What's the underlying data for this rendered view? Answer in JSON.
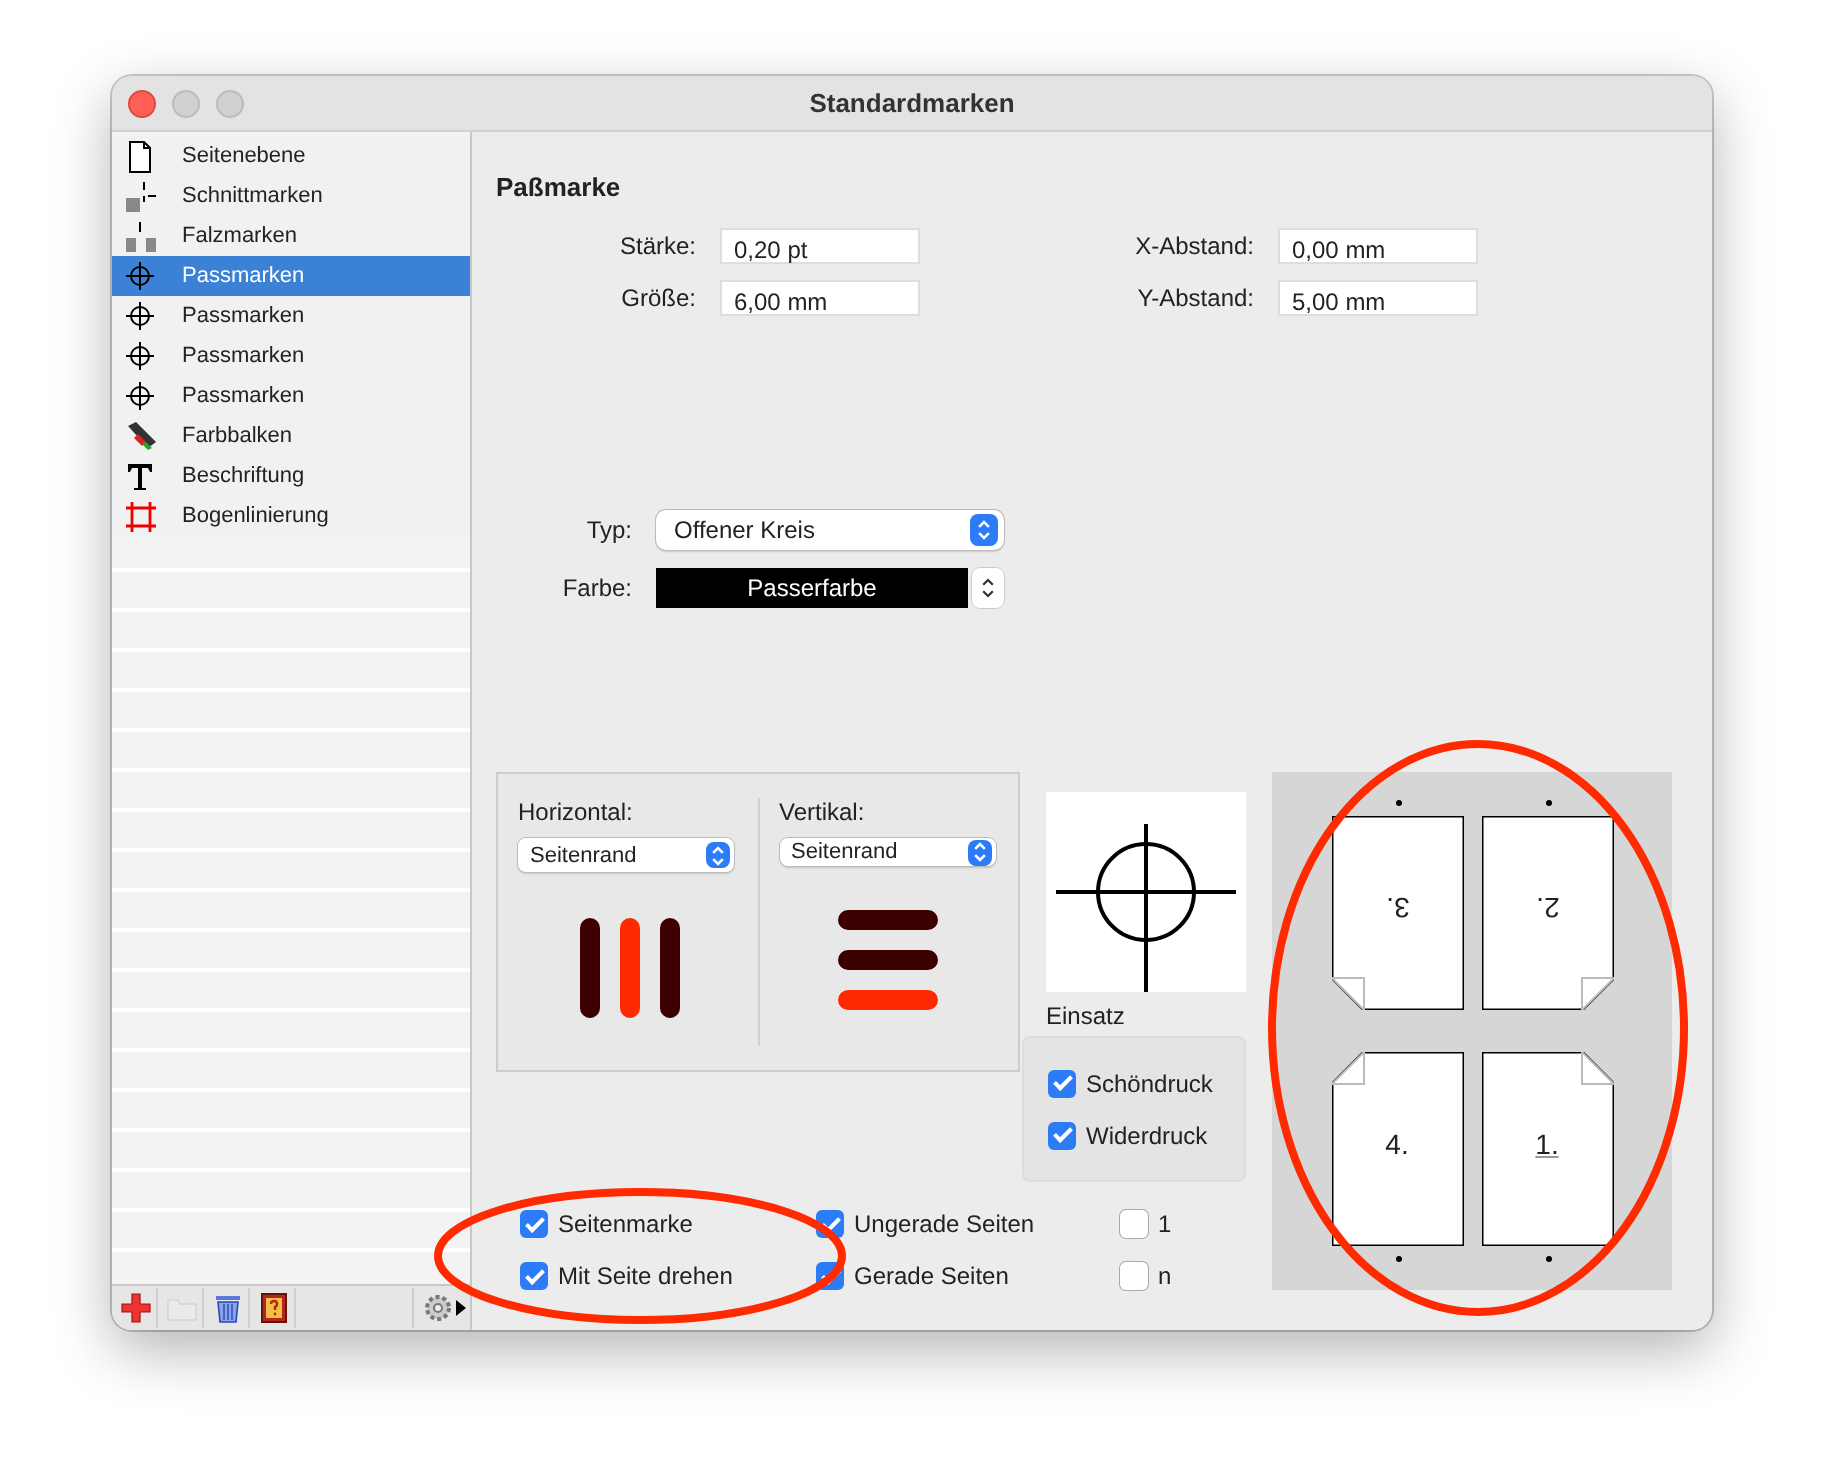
{
  "window": {
    "title": "Standardmarken"
  },
  "sidebar": {
    "items": [
      {
        "label": "Seitenebene",
        "kind": "page",
        "selected": false
      },
      {
        "label": "Schnittmarken",
        "kind": "cut",
        "selected": false
      },
      {
        "label": "Falzmarken",
        "kind": "fold",
        "selected": false
      },
      {
        "label": "Passmarken",
        "kind": "register",
        "selected": true
      },
      {
        "label": "Passmarken",
        "kind": "register",
        "selected": false
      },
      {
        "label": "Passmarken",
        "kind": "register",
        "selected": false
      },
      {
        "label": "Passmarken",
        "kind": "register",
        "selected": false
      },
      {
        "label": "Farbbalken",
        "kind": "colorbar",
        "selected": false
      },
      {
        "label": "Beschriftung",
        "kind": "text",
        "selected": false
      },
      {
        "label": "Bogenlinierung",
        "kind": "grid",
        "selected": false
      }
    ],
    "toolbar": [
      {
        "kind": "add",
        "disabled": false
      },
      {
        "kind": "folder",
        "disabled": true
      },
      {
        "kind": "trash",
        "disabled": false
      },
      {
        "kind": "help",
        "disabled": false
      }
    ]
  },
  "panel": {
    "title": "Paßmarke",
    "fields": [
      {
        "label": "Stärke:",
        "value": "0,20 pt"
      },
      {
        "label": "X-Abstand:",
        "value": "0,00 mm"
      },
      {
        "label": "Größe:",
        "value": "6,00 mm"
      },
      {
        "label": "Y-Abstand:",
        "value": "5,00 mm"
      }
    ],
    "typ": {
      "label": "Typ:",
      "value": "Offener Kreis"
    },
    "farbe": {
      "label": "Farbe:",
      "value": "Passerfarbe"
    },
    "horizontal": {
      "label": "Horizontal:",
      "value": "Seitenrand",
      "bars": [
        {
          "color": "#3c0000"
        },
        {
          "color": "#ff2a00"
        },
        {
          "color": "#3c0000"
        }
      ]
    },
    "vertikal": {
      "label": "Vertikal:",
      "value": "Seitenrand",
      "bars": [
        {
          "color": "#3c0000"
        },
        {
          "color": "#3c0000"
        },
        {
          "color": "#ff2a00"
        }
      ]
    },
    "einsatz": {
      "label": "Einsatz",
      "options": [
        {
          "label": "Schöndruck",
          "checked": true
        },
        {
          "label": "Widerdruck",
          "checked": true
        }
      ]
    },
    "checkboxes": [
      {
        "label": "Seitenmarke",
        "checked": true
      },
      {
        "label": "Ungerade Seiten",
        "checked": true
      },
      {
        "label": "1",
        "checked": false
      },
      {
        "label": "Mit Seite drehen",
        "checked": true
      },
      {
        "label": "Gerade Seiten",
        "checked": true
      },
      {
        "label": "n",
        "checked": false
      }
    ],
    "pages": [
      {
        "label": "3.",
        "rotated": true,
        "kind": "bottomleft",
        "underlined": false
      },
      {
        "label": "2.",
        "rotated": true,
        "kind": "bottomright",
        "underlined": false
      },
      {
        "label": "4.",
        "rotated": false,
        "kind": "topleft",
        "underlined": false
      },
      {
        "label": "1.",
        "rotated": false,
        "kind": "topright",
        "underlined": true
      }
    ]
  }
}
